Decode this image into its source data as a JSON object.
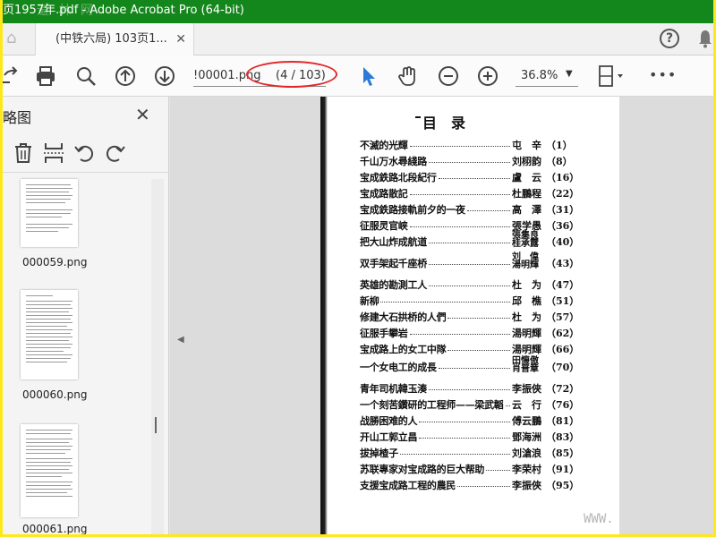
{
  "window": {
    "title": "页1957年.pdf - Adobe Acrobat Pro (64-bit)",
    "watermark": "道 林 网"
  },
  "tabbar": {
    "tab_label": "(中铁六局) 103页1...",
    "close": "✕",
    "help": "?"
  },
  "toolbar": {
    "filename": "!00001.png",
    "page_indicator": "(4 / 103)",
    "zoom": "36.8%",
    "zoom_dropdown": "▼",
    "more": "•••"
  },
  "sidebar": {
    "title": "略图",
    "close": "✕",
    "thumbnails": [
      {
        "label": "000059.png"
      },
      {
        "label": "000060.png"
      },
      {
        "label": "000061.png"
      }
    ]
  },
  "docarea": {
    "collapse_arrow": "◀"
  },
  "document": {
    "toc_title": "目　录",
    "watermark": "WWW.",
    "entries": [
      {
        "title": "不滅的光輝",
        "author": "屯　辛",
        "page": "（1）"
      },
      {
        "title": "千山万水尋綫路",
        "author": "刘栩韵",
        "page": "（8）"
      },
      {
        "title": "宝成鉄路北段紀行",
        "author": "盧　云",
        "page": "（16）"
      },
      {
        "title": "宝成路散記",
        "author": "杜鵬程",
        "page": "（22）"
      },
      {
        "title": "宝成鉄路接軌前夕的一夜",
        "author": "高　澤",
        "page": "（31）"
      },
      {
        "title": "征服灵官峡",
        "author": "張学愚",
        "page": "（36）"
      },
      {
        "title": "把大山炸成航道",
        "author": "張集良 桂承露",
        "page": "（40）"
      },
      {
        "title": "双手架起千座桥",
        "author": "刘　偉 湯明輝",
        "page": "（43）"
      },
      {
        "title": "英雄的勘測工人",
        "author": "杜　为",
        "page": "（47）"
      },
      {
        "title": "新柳",
        "author": "邱　樵",
        "page": "（51）"
      },
      {
        "title": "修建大石拱桥的人們",
        "author": "杜　为",
        "page": "（57）"
      },
      {
        "title": "征服手攀岩",
        "author": "湯明輝",
        "page": "（62）"
      },
      {
        "title": "宝成路上的女工中隊",
        "author": "湯明輝",
        "page": "（66）"
      },
      {
        "title": "一个女电工的成長",
        "author": "田懐傲 肖普章",
        "page": "（70）"
      },
      {
        "title": "青年司机韓玉湊",
        "author": "李振俠",
        "page": "（72）"
      },
      {
        "title": "一个刻苦鑽研的工程师——梁武韜",
        "author": "云　行",
        "page": "（76）"
      },
      {
        "title": "战勝困难的人",
        "author": "傅云鵬",
        "page": "（81）"
      },
      {
        "title": "开山工郭立昌",
        "author": "鄧海洲",
        "page": "（83）"
      },
      {
        "title": "拔掉楂子",
        "author": "刘滄浪",
        "page": "（85）"
      },
      {
        "title": "苏联專家对宝成路的巨大帮助",
        "author": "李荣村",
        "page": "（91）"
      },
      {
        "title": "支援宝成路工程的農民",
        "author": "李振俠",
        "page": "（95）"
      }
    ]
  },
  "colors": {
    "titlebar": "#14871c",
    "outer_border": "#ffe81a",
    "annotation": "#e3262a",
    "select_tool": "#2a7ad8"
  }
}
